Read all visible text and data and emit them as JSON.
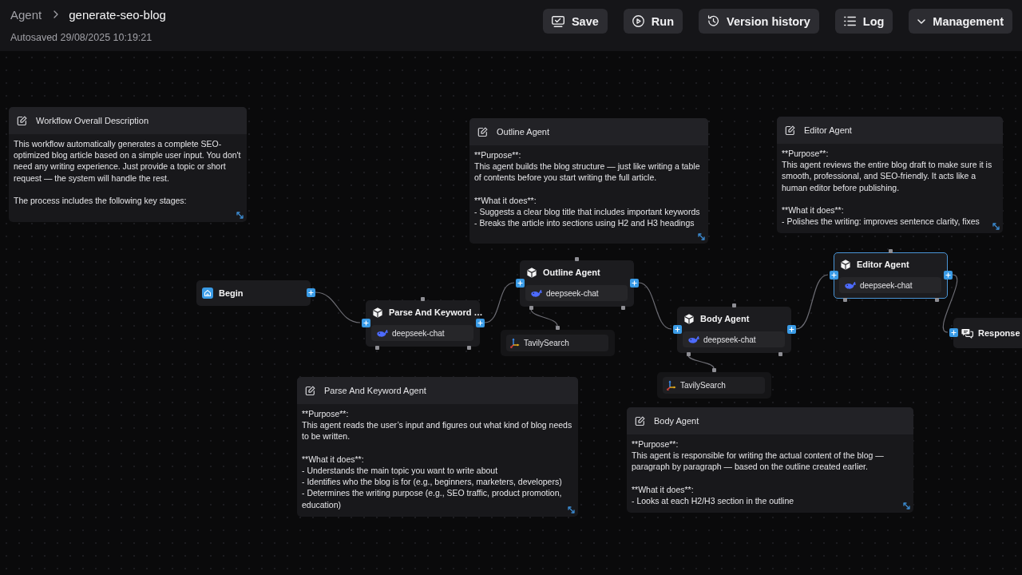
{
  "header": {
    "breadcrumb": {
      "parent": "Agent",
      "current": "generate-seo-blog"
    },
    "autosave": "Autosaved 29/08/2025 10:19:21",
    "buttons": [
      {
        "label": "Save"
      },
      {
        "label": "Run"
      },
      {
        "label": "Version history"
      },
      {
        "label": "Log"
      },
      {
        "label": "Management"
      }
    ]
  },
  "notes": [
    {
      "title": "Workflow Overall Description",
      "paragraphs": [
        [
          "This workflow automatically generates a complete SEO-optimized blog article based on a simple user input. You don't need any writing experience. Just provide a topic or short request — the system will handle the rest."
        ],
        [
          "The process includes the following key stages:"
        ]
      ]
    },
    {
      "title": "Outline Agent",
      "paragraphs": [
        [
          "**Purpose**:",
          "This agent builds the blog structure — just like writing a table of contents before you start writing the full article."
        ],
        [
          "**What it does**:",
          "- Suggests a clear blog title that includes important keywords",
          "- Breaks the article into sections using H2 and H3 headings"
        ]
      ]
    },
    {
      "title": "Editor Agent",
      "paragraphs": [
        [
          "**Purpose**:",
          "This agent reviews the entire blog draft to make sure it is smooth, professional, and SEO-friendly. It acts like a human editor before publishing."
        ],
        [
          "**What it does**:",
          "- Polishes the writing: improves sentence clarity, fixes"
        ]
      ]
    },
    {
      "title": "Parse And Keyword Agent",
      "paragraphs": [
        [
          "**Purpose**:",
          "This agent reads the user’s input and figures out what kind of blog needs to be written."
        ],
        [
          "**What it does**:",
          "- Understands the main topic you want to write about",
          "- Identifies who the blog is for (e.g., beginners, marketers, developers)",
          "- Determines the writing purpose (e.g., SEO traffic, product promotion, education)"
        ]
      ]
    },
    {
      "title": "Body Agent",
      "paragraphs": [
        [
          "**Purpose**:",
          "This agent is responsible for writing the actual content of the blog — paragraph by paragraph — based on the outline created earlier."
        ],
        [
          "**What it does**:",
          "- Looks at each H2/H3 section in the outline"
        ]
      ]
    }
  ],
  "nodes": [
    {
      "kind": "begin",
      "label": "Begin",
      "selected": false
    },
    {
      "kind": "agent",
      "label": "Parse And Keyword …",
      "model": "deepseek-chat",
      "selected": false
    },
    {
      "kind": "agent",
      "label": "Outline Agent",
      "model": "deepseek-chat",
      "selected": false,
      "tools": [
        {
          "name": "TavilySearch"
        }
      ]
    },
    {
      "kind": "agent",
      "label": "Body Agent",
      "model": "deepseek-chat",
      "selected": false,
      "tools": [
        {
          "name": "TavilySearch"
        }
      ]
    },
    {
      "kind": "agent",
      "label": "Editor Agent",
      "model": "deepseek-chat",
      "selected": true
    },
    {
      "kind": "message",
      "label": "Response",
      "selected": false
    }
  ]
}
